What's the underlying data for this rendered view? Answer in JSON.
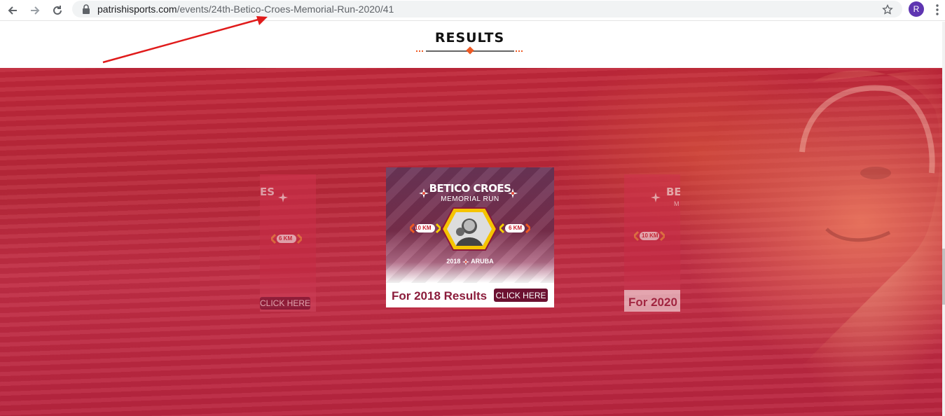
{
  "browser": {
    "url_domain": "patrishisports.com",
    "url_path": "/events/24th-Betico-Croes-Memorial-Run-2020/41",
    "profile_initial": "R",
    "icons": [
      "back-arrow-icon",
      "forward-arrow-icon",
      "reload-icon",
      "lock-icon",
      "bookmark-star-icon",
      "kebab-menu-icon"
    ]
  },
  "page": {
    "section_title": "RESULTS",
    "accent_color": "#ee5a24",
    "hero_color": "#c0283a"
  },
  "carousel": {
    "center": {
      "title": "BETICO CROES",
      "subtitle": "MEMORIAL RUN",
      "km_left": "10 KM",
      "km_right": "6 KM",
      "year_place_prefix": "2018",
      "year_place_suffix": "ARUBA",
      "footer_text": "For 2018 Results",
      "button_label": "CLICK HERE"
    },
    "left": {
      "title_fragment": "ES",
      "km": "6 KM",
      "button_label": "CLICK HERE"
    },
    "right": {
      "title_fragment": "BE",
      "sub_fragment": "M",
      "km": "10 KM",
      "footer_text": "For 2020"
    }
  }
}
